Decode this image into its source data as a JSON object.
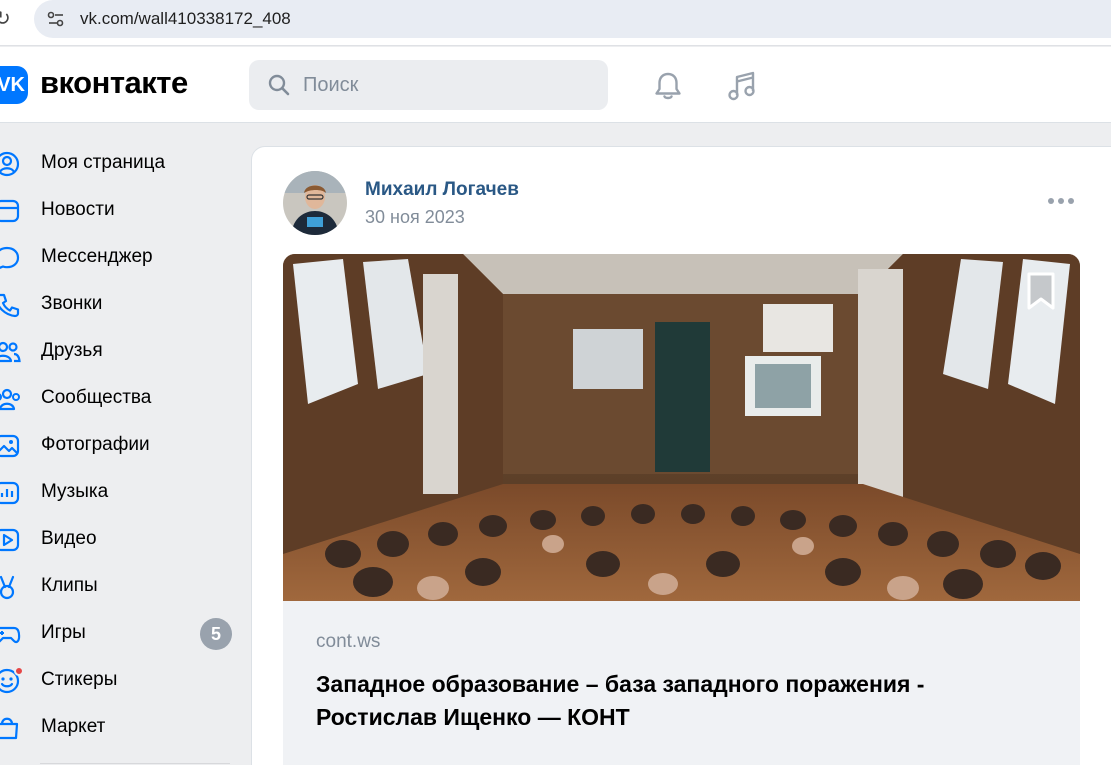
{
  "browser": {
    "url": "vk.com/wall410338172_408"
  },
  "header": {
    "logo_mark": "VK",
    "logo_text": "вконтакте",
    "search_placeholder": "Поиск"
  },
  "nav": {
    "items": [
      {
        "label": "Моя страница",
        "icon": "profile-icon"
      },
      {
        "label": "Новости",
        "icon": "news-icon"
      },
      {
        "label": "Мессенджер",
        "icon": "messenger-icon"
      },
      {
        "label": "Звонки",
        "icon": "phone-icon"
      },
      {
        "label": "Друзья",
        "icon": "friends-icon"
      },
      {
        "label": "Сообщества",
        "icon": "communities-icon"
      },
      {
        "label": "Фотографии",
        "icon": "photos-icon"
      },
      {
        "label": "Музыка",
        "icon": "music-icon"
      },
      {
        "label": "Видео",
        "icon": "video-icon"
      },
      {
        "label": "Клипы",
        "icon": "clips-icon"
      },
      {
        "label": "Игры",
        "icon": "games-icon",
        "counter": "5"
      },
      {
        "label": "Стикеры",
        "icon": "stickers-icon"
      },
      {
        "label": "Маркет",
        "icon": "market-icon"
      }
    ]
  },
  "post": {
    "author": "Михаил Логачев",
    "date": "30 ноя 2023",
    "link": {
      "domain": "cont.ws",
      "title": "Западное образование – база западного поражения - Ростислав Ищенко — КОНТ"
    }
  },
  "colors": {
    "accent": "#0077ff",
    "link": "#2a5885",
    "secondary_text": "#818c99",
    "page_bg": "#edeef0"
  }
}
